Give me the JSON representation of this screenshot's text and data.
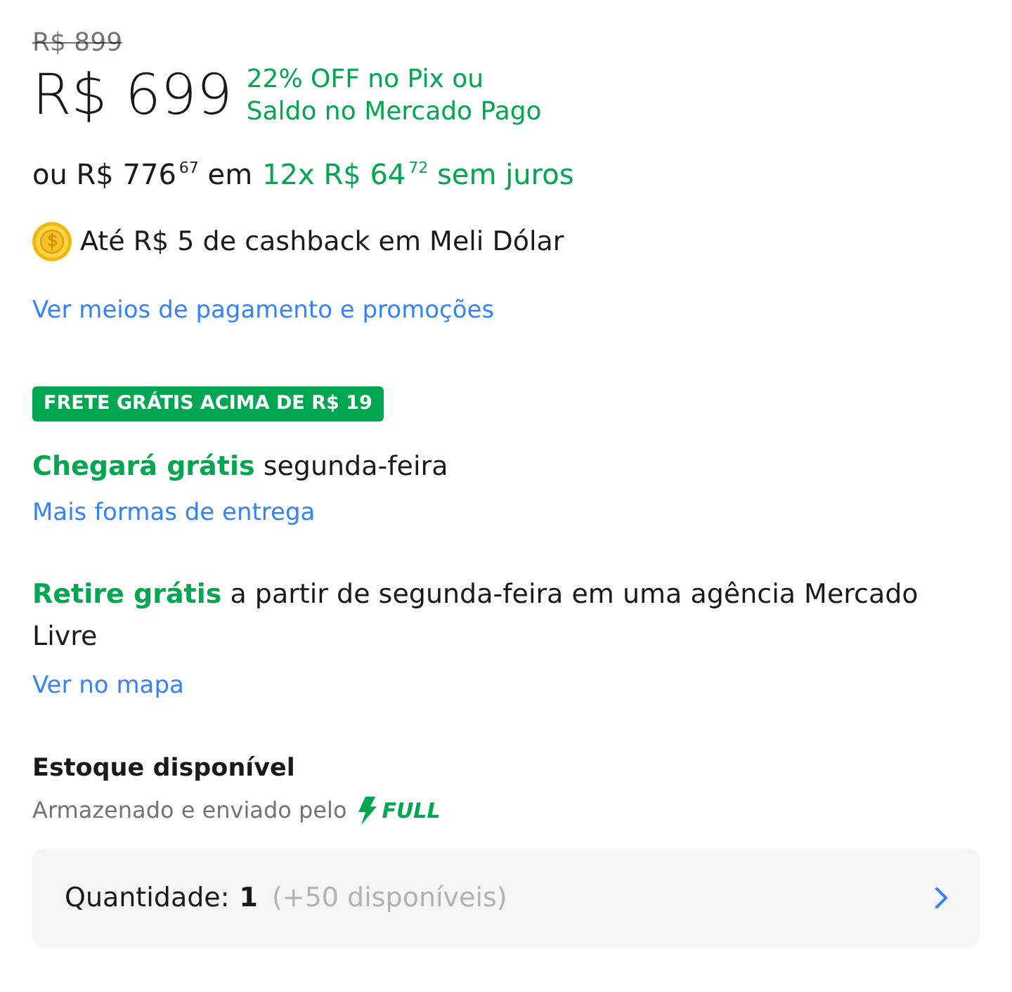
{
  "price": {
    "original": "R$ 899",
    "current": "R$ 699",
    "pix_discount": "22% OFF no Pix ou Saldo no Mercado Pago"
  },
  "installments": {
    "total": "ou R$ 776$^{67}$ em",
    "offer": "12x R$ 64$^{72}$ sem juros"
  },
  "cashback": {
    "text": "Até R$ 5 de cashback em Meli Dólar"
  },
  "payment_link": "Ver meios de pagamento e promoções",
  "shipping": {
    "badge": "FRETE GRÁTIS ACIMA DE R$ 19",
    "delivery": "**Chegará grátis** segunda-feira",
    "delivery_link": "Mais formas de entrega",
    "pickup": "**Retire grátis** a partir de segunda-feira em uma agência Mercado Livre",
    "pickup_link": "Ver no mapa"
  },
  "stock": {
    "title": "Estoque disponível",
    "fulfillment_text": "Armazenado e enviado pelo",
    "fulfillment_logo": "FULL"
  },
  "quantity": {
    "label": "Quantidade:",
    "value": "1",
    "available": "(+50 disponíveis)"
  }
}
